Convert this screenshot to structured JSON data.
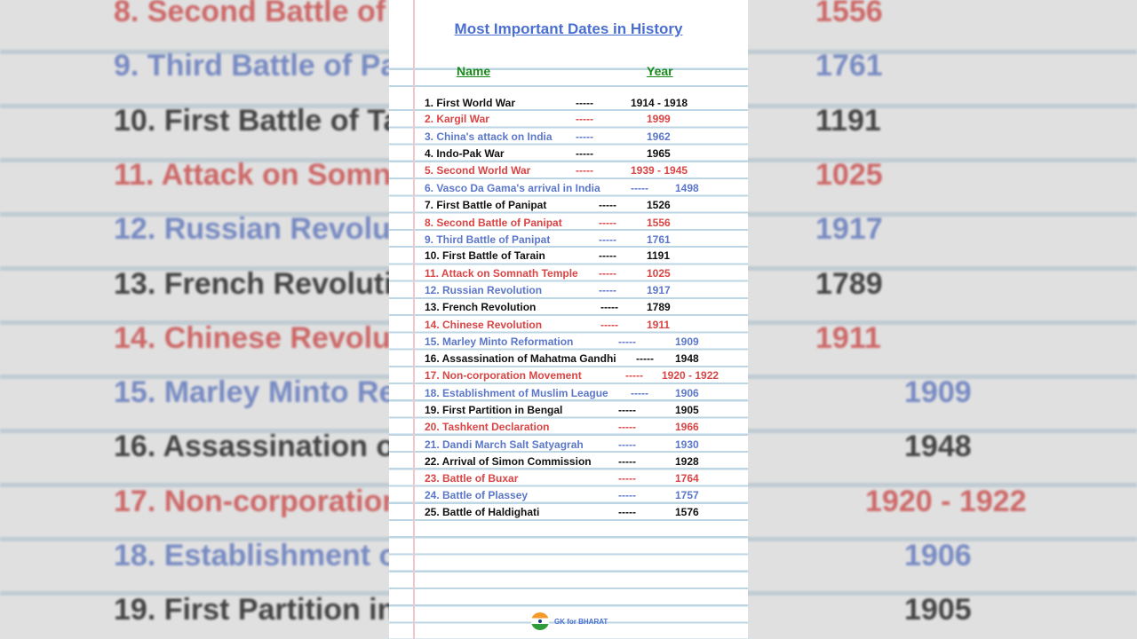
{
  "title": "Most Important Dates in History",
  "headers": {
    "name": "Name",
    "year": "Year"
  },
  "dash": "-----",
  "brand": "GK for BHARAT",
  "colors": {
    "red": "#d94545",
    "blue": "#5b77c9",
    "black": "#111111",
    "green": "#1a8a1a"
  },
  "rows": [
    {
      "name": "1. First World War",
      "year": "1914 - 1918",
      "color": "black"
    },
    {
      "name": "2. Kargil War",
      "year": "1999",
      "color": "red"
    },
    {
      "name": "3. China's attack on India",
      "year": "1962",
      "color": "blue"
    },
    {
      "name": "4. Indo-Pak War",
      "year": "1965",
      "color": "black"
    },
    {
      "name": "5. Second World War",
      "year": "1939 - 1945",
      "color": "red"
    },
    {
      "name": "6. Vasco Da Gama's arrival in India",
      "year": "1498",
      "color": "blue"
    },
    {
      "name": "7. First Battle of Panipat",
      "year": "1526",
      "color": "black"
    },
    {
      "name": "8. Second Battle of Panipat",
      "year": "1556",
      "color": "red"
    },
    {
      "name": "9. Third Battle of Panipat",
      "year": "1761",
      "color": "blue"
    },
    {
      "name": "10. First Battle of Tarain",
      "year": "1191",
      "color": "black"
    },
    {
      "name": "11. Attack on Somnath Temple",
      "year": "1025",
      "color": "red"
    },
    {
      "name": "12. Russian Revolution",
      "year": "1917",
      "color": "blue"
    },
    {
      "name": "13. French Revolution",
      "year": "1789",
      "color": "black"
    },
    {
      "name": "14. Chinese Revolution",
      "year": "1911",
      "color": "red"
    },
    {
      "name": "15. Marley Minto Reformation",
      "year": "1909",
      "color": "blue"
    },
    {
      "name": "16. Assassination of Mahatma Gandhi",
      "year": "1948",
      "color": "black"
    },
    {
      "name": "17. Non-corporation Movement",
      "year": "1920 - 1922",
      "color": "red"
    },
    {
      "name": "18. Establishment of Muslim League",
      "year": "1906",
      "color": "blue"
    },
    {
      "name": "19. First Partition in Bengal",
      "year": "1905",
      "color": "black"
    },
    {
      "name": "20. Tashkent Declaration",
      "year": "1966",
      "color": "red"
    },
    {
      "name": "21. Dandi March Salt Satyagrah",
      "year": "1930",
      "color": "blue"
    },
    {
      "name": "22. Arrival of Simon Commission",
      "year": "1928",
      "color": "black"
    },
    {
      "name": "23. Battle of Buxar",
      "year": "1764",
      "color": "red"
    },
    {
      "name": "24. Battle of Plassey",
      "year": "1757",
      "color": "blue"
    },
    {
      "name": "25. Battle of Haldighati",
      "year": "1576",
      "color": "black"
    }
  ]
}
